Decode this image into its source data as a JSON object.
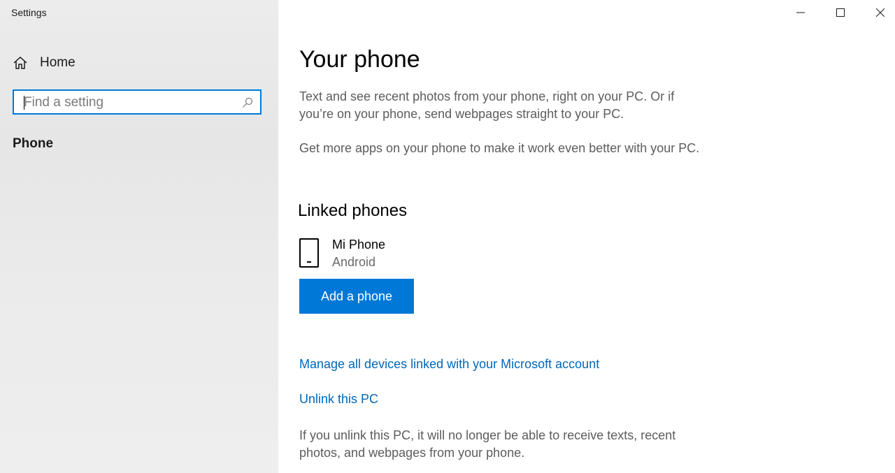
{
  "window": {
    "title": "Settings",
    "controls": {
      "minimize_icon": "minimize-icon",
      "maximize_icon": "maximize-icon",
      "close_icon": "close-icon"
    }
  },
  "sidebar": {
    "home_label": "Home",
    "home_icon": "home-icon",
    "search": {
      "placeholder": "Find a setting",
      "value": "",
      "icon": "search-icon"
    },
    "section_label": "Phone"
  },
  "main": {
    "title": "Your phone",
    "description_1": "Text and see recent photos from your phone, right on your PC. Or if you’re on your phone, send webpages straight to your PC.",
    "description_2": "Get more apps on your phone to make it work even better with your PC.",
    "linked_phones": {
      "heading": "Linked phones",
      "devices": [
        {
          "name": "Mi Phone",
          "os": "Android",
          "icon": "phone-icon"
        }
      ],
      "add_button_label": "Add a phone"
    },
    "links": {
      "manage_devices": "Manage all devices linked with your Microsoft account",
      "unlink_pc": "Unlink this PC"
    },
    "unlink_note": "If you unlink this PC, it will no longer be able to receive texts, recent photos, and webpages from your phone."
  },
  "colors": {
    "accent": "#0078d7",
    "link": "#0067b8",
    "sidebar_bg": "#e6e6e6",
    "body_text": "#5c5c5c"
  }
}
